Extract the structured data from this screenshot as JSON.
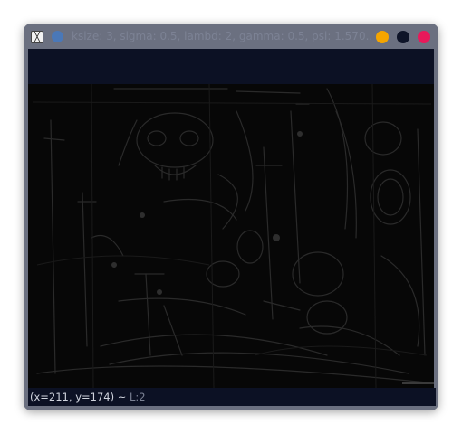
{
  "window": {
    "title": "ksize: 3, sigma: 0.5, lambd: 2, gamma: 0.5, psi: 1.570..."
  },
  "statusbar": {
    "coords": "(x=211, y=174) ~ ",
    "layer": "L:2"
  },
  "colors": {
    "frame": "#6b7080",
    "bar": "#0c1124",
    "canvas": "#070707",
    "minimize": "#f5a500",
    "maximize": "#0e1428",
    "close": "#e8195a"
  }
}
